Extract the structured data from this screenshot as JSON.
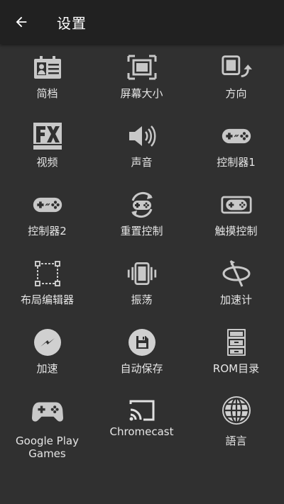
{
  "header": {
    "title": "设置",
    "back_icon": "arrow-back-icon"
  },
  "items": [
    {
      "label": "简档",
      "icon": "profile-card-icon"
    },
    {
      "label": "屏幕大小",
      "icon": "screen-size-icon"
    },
    {
      "label": "方向",
      "icon": "rotate-screen-icon"
    },
    {
      "label": "视频",
      "icon": "fx-video-icon"
    },
    {
      "label": "声音",
      "icon": "speaker-icon"
    },
    {
      "label": "控制器1",
      "icon": "gamepad-icon"
    },
    {
      "label": "控制器2",
      "icon": "gamepad-icon"
    },
    {
      "label": "重置控制",
      "icon": "reset-controls-icon"
    },
    {
      "label": "触摸控制",
      "icon": "touch-controls-icon"
    },
    {
      "label": "布局编辑器",
      "icon": "layout-editor-icon"
    },
    {
      "label": "振荡",
      "icon": "vibrate-icon"
    },
    {
      "label": "加速计",
      "icon": "accelerometer-icon"
    },
    {
      "label": "加速",
      "icon": "speed-boost-icon"
    },
    {
      "label": "自动保存",
      "icon": "save-icon"
    },
    {
      "label": "ROM目录",
      "icon": "file-cabinet-icon"
    },
    {
      "label": "Google Play Games",
      "icon": "play-games-controller-icon"
    },
    {
      "label": "Chromecast",
      "icon": "cast-icon"
    },
    {
      "label": "語言",
      "icon": "globe-icon"
    }
  ]
}
